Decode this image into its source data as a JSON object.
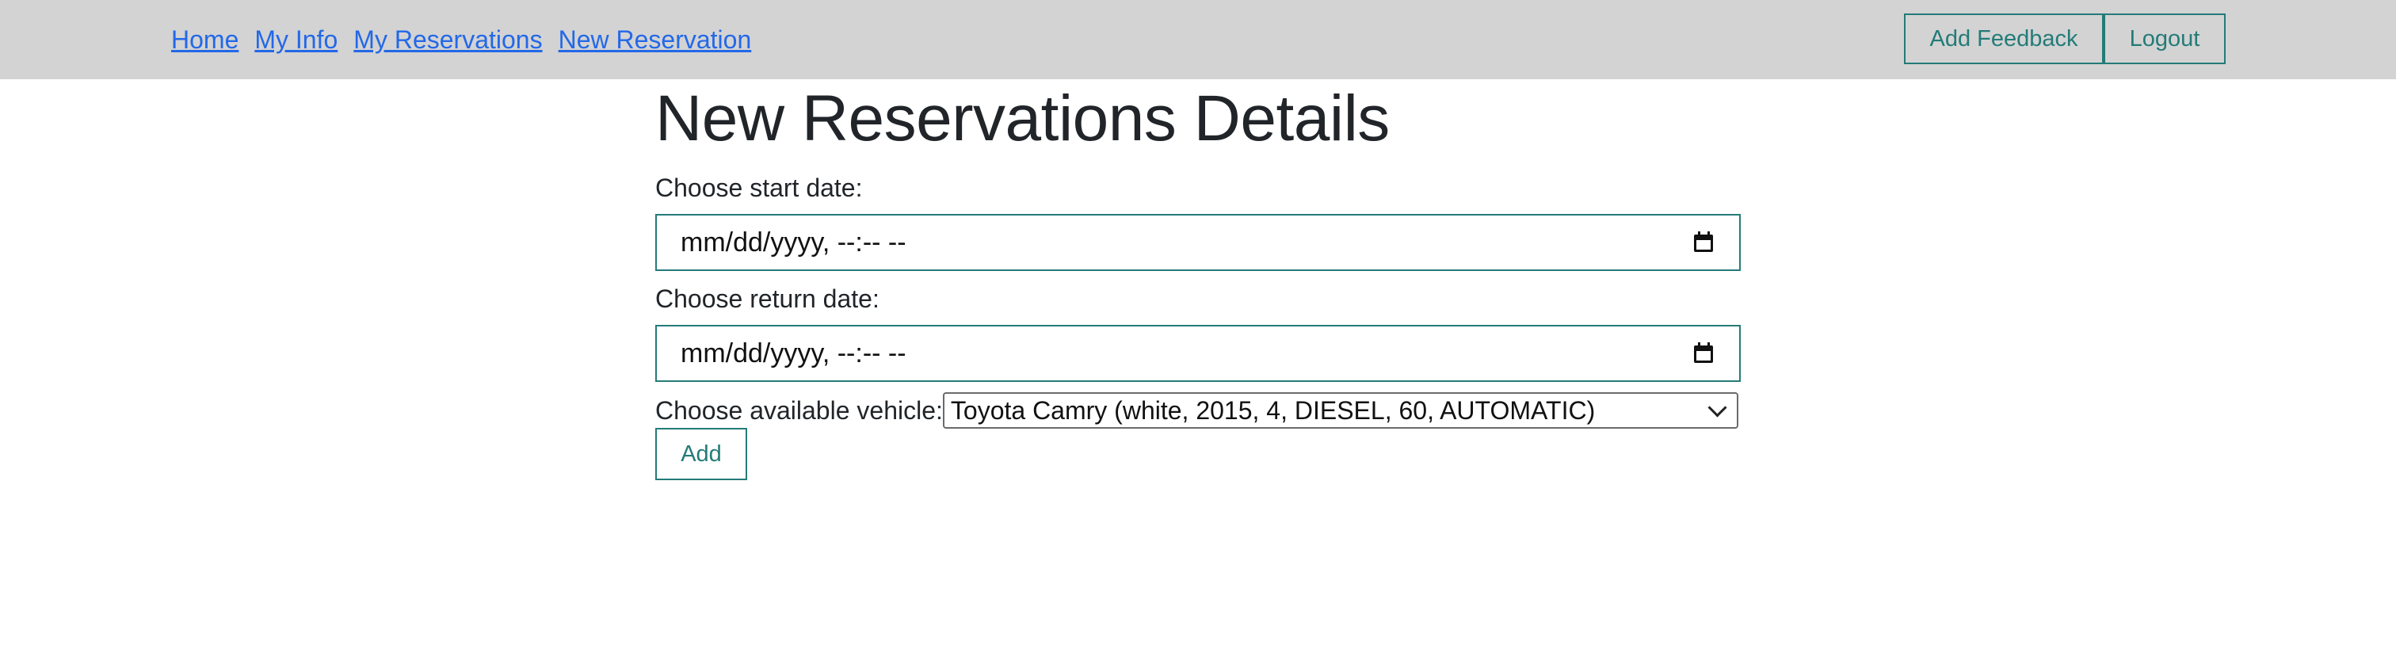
{
  "nav": {
    "links": [
      "Home",
      "My Info",
      "My Reservations",
      "New Reservation"
    ],
    "add_feedback_label": "Add Feedback",
    "logout_label": "Logout"
  },
  "form": {
    "title": "New Reservations Details",
    "start_label": "Choose start date:",
    "start_value": "mm/dd/yyyy, --:-- --",
    "return_label": "Choose return date:",
    "return_value": "mm/dd/yyyy, --:-- --",
    "vehicle_label": "Choose available vehicle:",
    "vehicle_selected": "Toyota Camry (white, 2015, 4, DIESEL, 60, AUTOMATIC)",
    "add_label": "Add"
  },
  "colors": {
    "navbar_bg": "#d3d3d3",
    "link": "#2368e8",
    "accent": "#247b78"
  },
  "icons": {
    "date_picker": "calendar-icon",
    "select_arrow": "chevron-down-icon"
  }
}
